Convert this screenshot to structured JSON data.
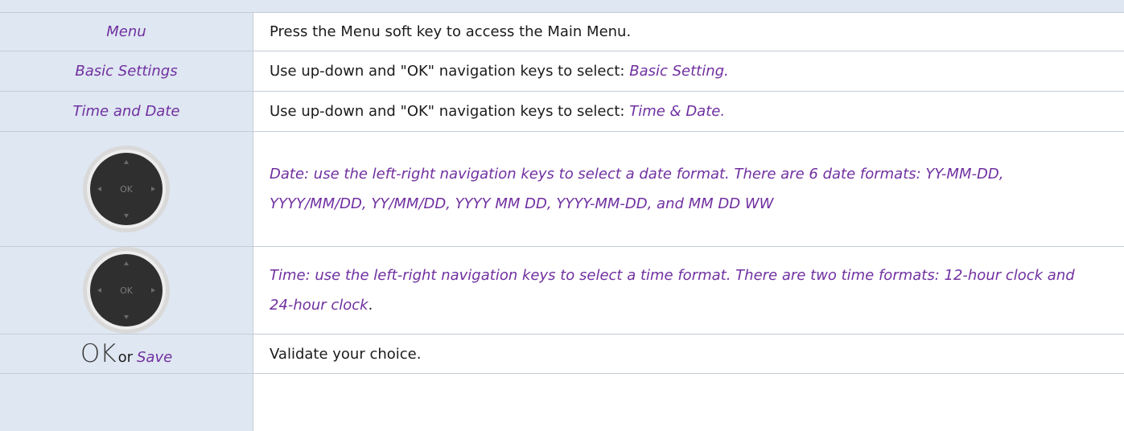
{
  "rows": [
    {
      "key": "Menu",
      "text": "Press the Menu soft key to access the Main Menu."
    },
    {
      "key": "Basic Settings",
      "text_prefix": "Use up-down and \"OK\" navigation keys to select: ",
      "text_em": "Basic Setting."
    },
    {
      "key": "Time and Date",
      "text_prefix": "Use up-down and \"OK\" navigation keys to select: ",
      "text_em": "Time & Date."
    },
    {
      "key_icon": "navigation-pad-icon",
      "pad_label": "OK",
      "text_em": "Date: use the left-right navigation keys to select a date format. There are 6 date formats: YY-MM-DD, YYYY/MM/DD, YY/MM/DD, YYYY MM DD, YYYY-MM-DD, and MM DD WW"
    },
    {
      "key_icon": "navigation-pad-icon",
      "pad_label": "OK",
      "text_em": "Time: use the left-right navigation keys to select a time format. There are two time formats: 12-hour clock and 24-hour clock",
      "text_suffix": "."
    },
    {
      "key_ok": "OK",
      "key_or": "or",
      "key_save": "Save",
      "text": "Validate your choice."
    },
    {
      "key": "",
      "text": ""
    }
  ],
  "colors": {
    "accent": "#7030a0",
    "band": "#dfe7f2",
    "rule": "#c4ccd6",
    "pad": "#333333"
  }
}
